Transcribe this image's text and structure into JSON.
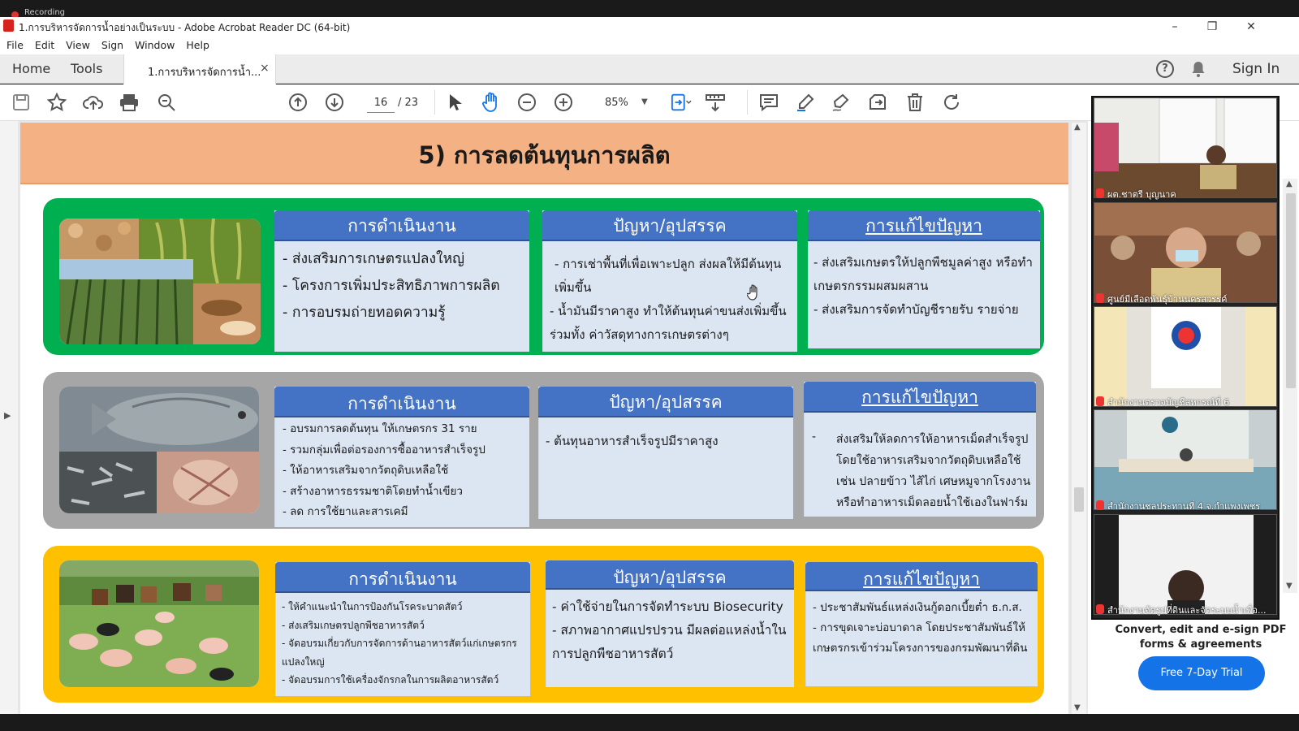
{
  "recording_label": "Recording",
  "window": {
    "title": "1.การบริหารจัดการน้ำอย่างเป็นระบบ - Adobe Acrobat Reader DC (64-bit)",
    "minimize": "–",
    "maximize": "❐",
    "close": "✕"
  },
  "menu": [
    "File",
    "Edit",
    "View",
    "Sign",
    "Window",
    "Help"
  ],
  "tabs": {
    "home": "Home",
    "tools": "Tools",
    "document": "1.การบริหารจัดการน้ำ...",
    "close": "×"
  },
  "header_right": {
    "help": "?",
    "sign_in": "Sign In"
  },
  "toolbar": {
    "page_current": "16",
    "page_total": "/ 23",
    "zoom": "85%"
  },
  "slide": {
    "title": "5) การลดต้นทุนการผลิต",
    "rows": [
      {
        "color": "#00b050",
        "operation_title": "การดำเนินงาน",
        "operation": [
          "- ส่งเสริมการเกษตรแปลงใหญ่",
          "- โครงการเพิ่มประสิทธิภาพการผลิต",
          "- การอบรมถ่ายทอดความรู้"
        ],
        "problem_title": "ปัญหา/อุปสรรค",
        "problem": [
          "- การเช่าพื้นที่เพื่อเพาะปลูก ส่งผลให้มีต้นทุนเพิ่มขึ้น",
          "- น้ำมันมีราคาสูง ทำให้ต้นทุนค่าขนส่งเพิ่มขึ้น ร่วมทั้ง ค่าวัสดุทางการเกษตรต่างๆ"
        ],
        "solution_title": "การแก้ไขปัญหา",
        "solution": [
          "- ส่งเสริมเกษตรให้ปลูกพืชมูลค่าสูง หรือทำเกษตรกรรมผสมผสาน",
          "- ส่งเสริมการจัดทำบัญชีรายรับ รายจ่าย"
        ]
      },
      {
        "color": "#a6a6a6",
        "operation_title": "การดำเนินงาน",
        "operation": [
          "- อบรมการลดต้นทุน ให้เกษตรกร 31 ราย",
          "- รวมกลุ่มเพื่อต่อรองการซื้ออาหารสำเร็จรูป",
          "- ให้อาหารเสริมจากวัตถุดิบเหลือใช้",
          "- สร้างอาหารธรรมชาติโดยทำน้ำเขียว",
          "- ลด การใช้ยาและสารเคมี"
        ],
        "problem_title": "ปัญหา/อุปสรรค",
        "problem": [
          "- ต้นทุนอาหารสำเร็จรูปมีราคาสูง"
        ],
        "solution_title": "การแก้ไขปัญหา",
        "solution": [
          "-",
          "ส่งเสริมให้ลดการให้อาหารเม็ดสำเร็จรูป โดยใช้อาหารเสริมจากวัตถุดิบเหลือใช้ เช่น ปลายข้าว ไส้ไก่ เศษหมูจากโรงงาน หรือทำอาหารเม็ดลอยน้ำใช้เองในฟาร์ม"
        ]
      },
      {
        "color": "#ffc000",
        "operation_title": "การดำเนินงาน",
        "operation": [
          "- ให้คำแนะนำในการป้องกันโรคระบาดสัตว์",
          "- ส่งเสริมเกษตรปลูกพืชอาหารสัตว์",
          "- จัดอบรมเกี่ยวกับการจัดการด้านอาหารสัตว์แก่เกษตรกรแปลงใหญ่",
          "- จัดอบรมการใช้เครื่องจักรกลในการผลิตอาหารสัตว์"
        ],
        "problem_title": "ปัญหา/อุปสรรค",
        "problem": [
          "- ค่าใช้จ่ายในการจัดทำระบบ Biosecurity",
          "- สภาพอากาศแปรปรวน มีผลต่อแหล่งน้ำในการปลูกพืชอาหารสัตว์"
        ],
        "solution_title": "การแก้ไขปัญหา",
        "solution": [
          "- ประชาสัมพันธ์แหล่งเงินกู้ดอกเบี้ยต่ำ ธ.ก.ส.",
          "- การขุดเจาะบ่อบาดาล โดยประชาสัมพันธ์ให้เกษตรกรเข้าร่วมโครงการของกรมพัฒนาที่ดิน"
        ]
      }
    ]
  },
  "participants": [
    "ผต.ชาตรี บุญนาค",
    "ศูนย์มีเลือดพันธุ์บ้านนครสวรรค์",
    "สำนักงานตรวจบัญชีสหกรณ์ที่ 6",
    "สำนักงานชลประทานที่ 4 จ.กำแพงเพชร",
    "สำนักงานจัดรูปที่ดินและจัดระบบน้ำเพื่อ..."
  ],
  "right_panel": {
    "cta": "Convert, edit and e-sign PDF forms & agreements",
    "trial_button": "Free 7-Day Trial"
  }
}
